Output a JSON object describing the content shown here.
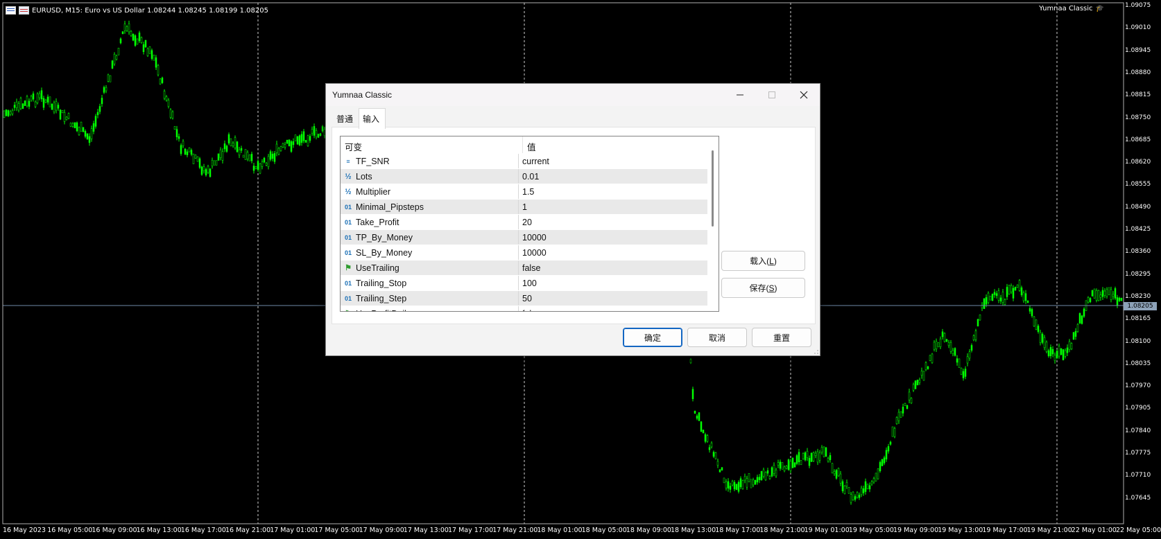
{
  "chart": {
    "symbol_info": "EURUSD, M15:  Euro vs US Dollar  1.08244 1.08245 1.08199 1.08205",
    "ea_name": "Yumnaa Classic",
    "current_price": "1.08205",
    "price_axis": [
      "1.09075",
      "1.09010",
      "1.08945",
      "1.08880",
      "1.08815",
      "1.08750",
      "1.08685",
      "1.08620",
      "1.08555",
      "1.08490",
      "1.08425",
      "1.08360",
      "1.08295",
      "1.08230",
      "1.08165",
      "1.08100",
      "1.08035",
      "1.07970",
      "1.07905",
      "1.07840",
      "1.07775",
      "1.07710",
      "1.07645"
    ],
    "time_axis": [
      "16 May 2023",
      "16 May 05:00",
      "16 May 09:00",
      "16 May 13:00",
      "16 May 17:00",
      "16 May 21:00",
      "17 May 01:00",
      "17 May 05:00",
      "17 May 09:00",
      "17 May 13:00",
      "17 May 17:00",
      "17 May 21:00",
      "18 May 01:00",
      "18 May 05:00",
      "18 May 09:00",
      "18 May 13:00",
      "18 May 17:00",
      "18 May 21:00",
      "19 May 01:00",
      "19 May 05:00",
      "19 May 09:00",
      "19 May 13:00",
      "19 May 17:00",
      "19 May 21:00",
      "22 May 01:00",
      "22 May 05:00"
    ],
    "candle_color": "#00ff00",
    "background": "#000000"
  },
  "dialog": {
    "title": "Yumnaa Classic",
    "tabs": [
      {
        "label": "普通"
      },
      {
        "label": "输入"
      }
    ],
    "active_tab": "输入",
    "table": {
      "headers": {
        "variable": "可变",
        "value": "值"
      },
      "rows": [
        {
          "icon": "enum-icon",
          "name": "TF_SNR",
          "value": "current"
        },
        {
          "icon": "double-icon",
          "name": "Lots",
          "value": "0.01"
        },
        {
          "icon": "double-icon",
          "name": "Multiplier",
          "value": "1.5"
        },
        {
          "icon": "int-icon",
          "name": "Minimal_Pipsteps",
          "value": "1"
        },
        {
          "icon": "int-icon",
          "name": "Take_Profit",
          "value": "20"
        },
        {
          "icon": "int-icon",
          "name": "TP_By_Money",
          "value": "10000"
        },
        {
          "icon": "int-icon",
          "name": "SL_By_Money",
          "value": "10000"
        },
        {
          "icon": "bool-icon",
          "name": "UseTrailing",
          "value": "false"
        },
        {
          "icon": "int-icon",
          "name": "Trailing_Stop",
          "value": "100"
        },
        {
          "icon": "int-icon",
          "name": "Trailing_Step",
          "value": "50"
        },
        {
          "icon": "bool-icon",
          "name": "UseProfitDaily",
          "value": "false"
        }
      ]
    },
    "side_buttons": {
      "load": "载入(",
      "load_key": "L",
      "save": "保存(",
      "save_key": "S",
      "close_paren": ")"
    },
    "footer_buttons": {
      "ok": "确定",
      "cancel": "取消",
      "reset": "重置"
    }
  }
}
